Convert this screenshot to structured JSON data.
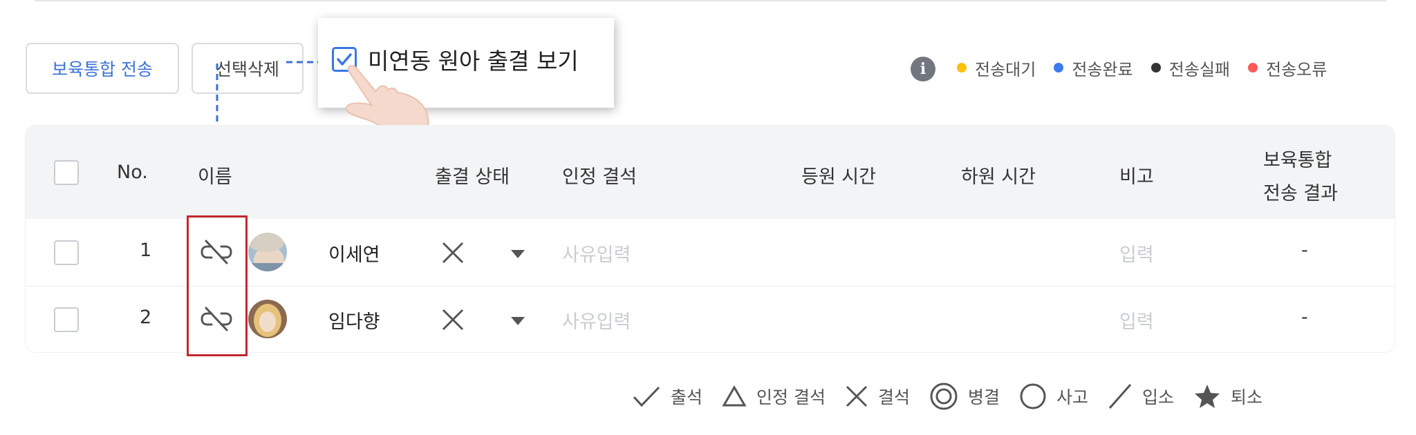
{
  "toolbar": {
    "send_button": "보육통합 전송",
    "delete_button": "선택삭제"
  },
  "popup": {
    "checkbox_label": "미연동 원아 출결 보기",
    "checked": true
  },
  "status_legend": {
    "items": [
      {
        "label": "전송대기",
        "color": "#ffc107"
      },
      {
        "label": "전송완료",
        "color": "#3b7cf0"
      },
      {
        "label": "전송실패",
        "color": "#333333"
      },
      {
        "label": "전송오류",
        "color": "#ff5a5a"
      }
    ]
  },
  "table": {
    "headers": {
      "no": "No.",
      "name": "이름",
      "attendance_status": "출결 상태",
      "approved_absence": "인정 결석",
      "arrival_time": "등원 시간",
      "departure_time": "하원 시간",
      "note": "비고",
      "transfer_result_line1": "보육통합",
      "transfer_result_line2": "전송 결과"
    },
    "rows": [
      {
        "no": "1",
        "name": "이세연",
        "status_icon": "x-mark-icon",
        "reason_placeholder": "사유입력",
        "note_placeholder": "입력",
        "result": "-",
        "link_icon": "unlink-icon"
      },
      {
        "no": "2",
        "name": "임다향",
        "status_icon": "x-mark-icon",
        "reason_placeholder": "사유입력",
        "note_placeholder": "입력",
        "result": "-",
        "link_icon": "unlink-icon"
      }
    ]
  },
  "attendance_legend": {
    "items": [
      {
        "symbol": "check-icon",
        "label": "출석"
      },
      {
        "symbol": "triangle-icon",
        "label": "인정 결석"
      },
      {
        "symbol": "x-mark-icon",
        "label": "결석"
      },
      {
        "symbol": "double-circle-icon",
        "label": "병결"
      },
      {
        "symbol": "circle-icon",
        "label": "사고"
      },
      {
        "symbol": "slash-icon",
        "label": "입소"
      },
      {
        "symbol": "star-icon",
        "label": "퇴소"
      }
    ]
  },
  "colors": {
    "accent_blue": "#3b73d9",
    "highlight_red": "#c2272d",
    "annotation_blue": "#3a6fd8"
  }
}
